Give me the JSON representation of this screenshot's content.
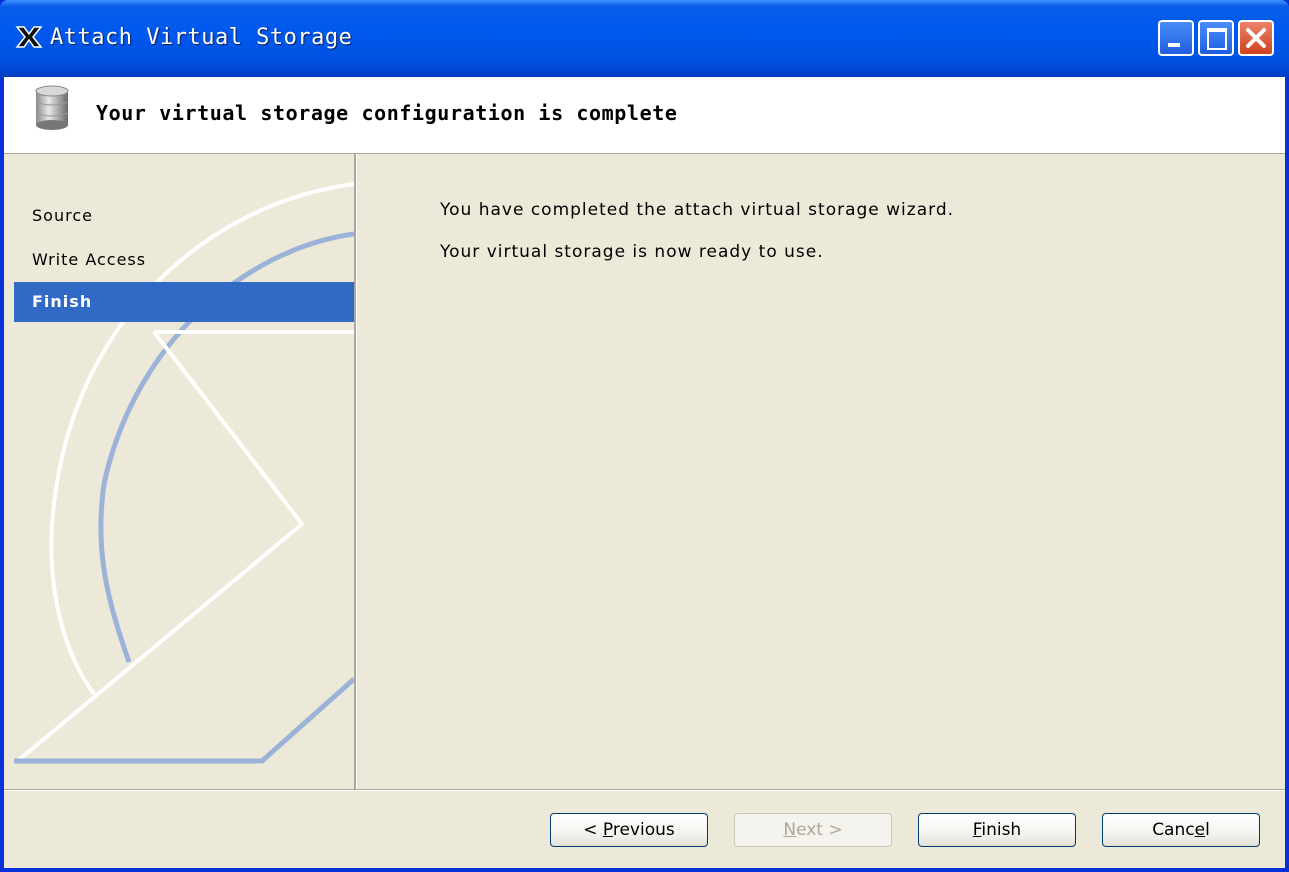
{
  "window": {
    "title": "Attach Virtual Storage",
    "app_icon": "x-app-icon",
    "controls": {
      "minimize": "minimize-icon",
      "maximize": "maximize-icon",
      "close": "close-icon"
    }
  },
  "header": {
    "icon": "disk-storage-icon",
    "title": "Your virtual storage configuration is complete"
  },
  "steps": [
    {
      "label": "Source",
      "active": false
    },
    {
      "label": "Write Access",
      "active": false
    },
    {
      "label": "Finish",
      "active": true
    }
  ],
  "main": {
    "line1": "You have completed the attach virtual storage wizard.",
    "line2": "Your virtual storage is now ready to use."
  },
  "buttons": {
    "previous": {
      "pre": "< ",
      "mnemonic": "P",
      "post": "revious",
      "enabled": true
    },
    "next": {
      "pre": "",
      "mnemonic": "N",
      "post": "ext >",
      "enabled": false
    },
    "finish": {
      "pre": "",
      "mnemonic": "F",
      "post": "inish",
      "enabled": true
    },
    "cancel": {
      "pre": "Canc",
      "mnemonic": "e",
      "post": "l",
      "enabled": true
    }
  },
  "colors": {
    "titlebar": "#0054e3",
    "selection": "#316ac5",
    "dialog_bg": "#ece9d8",
    "decor_blue": "#9bb3d8"
  }
}
